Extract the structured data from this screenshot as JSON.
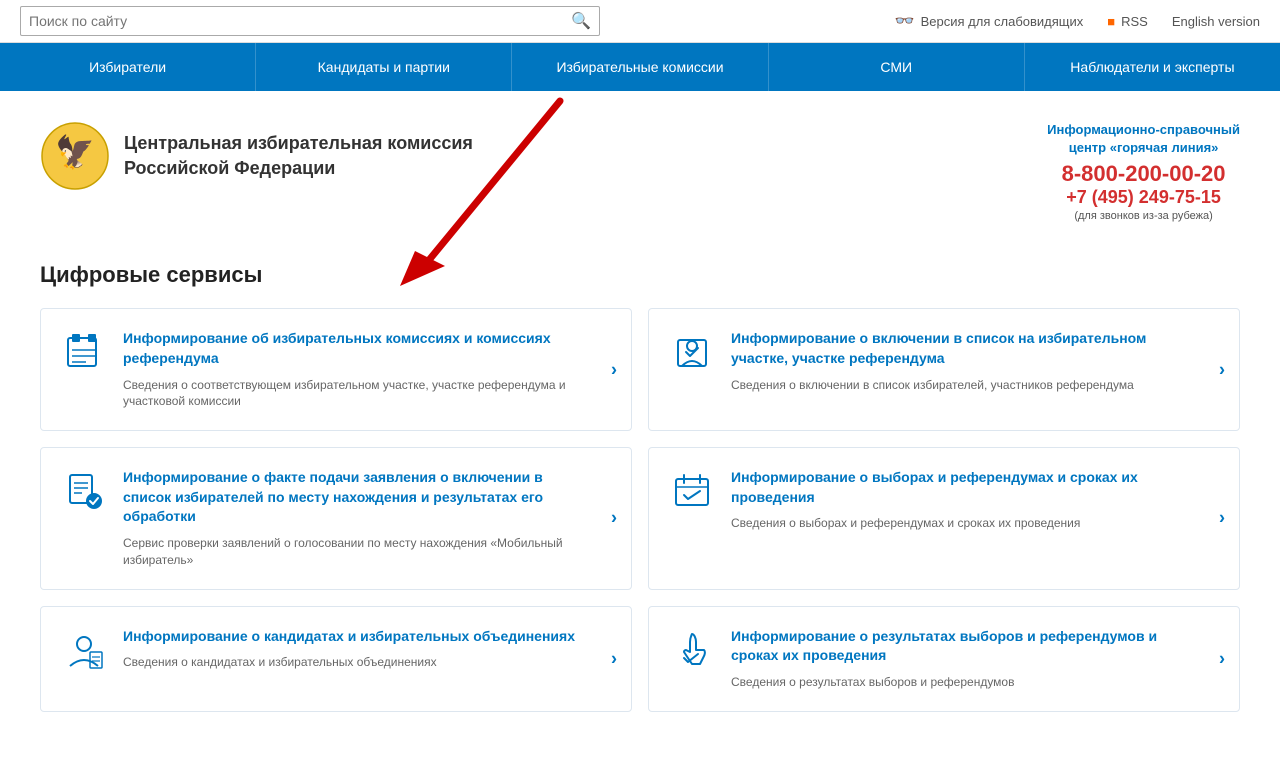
{
  "topbar": {
    "search_placeholder": "Поиск по сайту",
    "vision_label": "Версия для слабовидящих",
    "rss_label": "RSS",
    "english_label": "English version"
  },
  "nav": {
    "items": [
      {
        "id": "voters",
        "label": "Избиратели"
      },
      {
        "id": "candidates",
        "label": "Кандидаты и партии"
      },
      {
        "id": "commissions",
        "label": "Избирательные комиссии"
      },
      {
        "id": "media",
        "label": "СМИ"
      },
      {
        "id": "observers",
        "label": "Наблюдатели и эксперты"
      }
    ]
  },
  "header": {
    "org_name_line1": "Центральная избирательная комиссия",
    "org_name_line2": "Российской Федерации",
    "hotline_title_line1": "Информационно-справочный",
    "hotline_title_line2": "центр «горячая линия»",
    "hotline_main": "8-800-200-00-20",
    "hotline_alt": "+7 (495) 249-75-15",
    "hotline_note": "(для звонков из-за рубежа)"
  },
  "services": {
    "title": "Цифровые сервисы",
    "cards": [
      {
        "id": "card1",
        "title": "Информирование об избирательных комиссиях и комиссиях референдума",
        "desc": "Сведения о соответствующем избирательном участке, участке референдума и участковой комиссии",
        "icon": "ballot-box"
      },
      {
        "id": "card2",
        "title": "Информирование о включении в список на избирательном участке, участке референдума",
        "desc": "Сведения о включении в список избирателей, участников референдума",
        "icon": "list-check"
      },
      {
        "id": "card3",
        "title": "Информирование о факте подачи заявления о включении в список избирателей по месту нахождения и результатах его обработки",
        "desc": "Сервис проверки заявлений о голосовании по месту нахождения «Мобильный избиратель»",
        "icon": "document-list"
      },
      {
        "id": "card4",
        "title": "Информирование о выборах и референдумах и сроках их проведения",
        "desc": "Сведения о выборах и референдумах и сроках их проведения",
        "icon": "calendar-check"
      },
      {
        "id": "card5",
        "title": "Информирование о кандидатах и избирательных объединениях",
        "desc": "Сведения о кандидатах и избирательных объединениях",
        "icon": "person-badge"
      },
      {
        "id": "card6",
        "title": "Информирование о результатах выборов и референдумов и сроках их проведения",
        "desc": "Сведения о результатах выборов и референдумов",
        "icon": "hand-vote"
      }
    ]
  }
}
